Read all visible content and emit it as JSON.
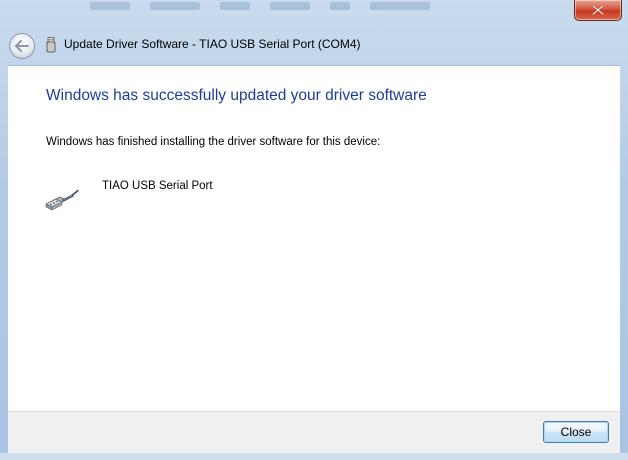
{
  "window": {
    "title": "Update Driver Software - TIAO USB Serial Port (COM4)",
    "title_icon": "usb-device-icon",
    "close_icon": "close-icon",
    "back_icon": "back-arrow-icon"
  },
  "main": {
    "heading": "Windows has successfully updated your driver software",
    "message": "Windows has finished installing the driver software for this device:",
    "device": {
      "name": "TIAO USB Serial Port",
      "icon": "serial-port-icon"
    }
  },
  "footer": {
    "close_label": "Close"
  },
  "colors": {
    "heading": "#1f3d96",
    "close_button_red": "#c7381f",
    "button_border": "#3c7fb1"
  }
}
